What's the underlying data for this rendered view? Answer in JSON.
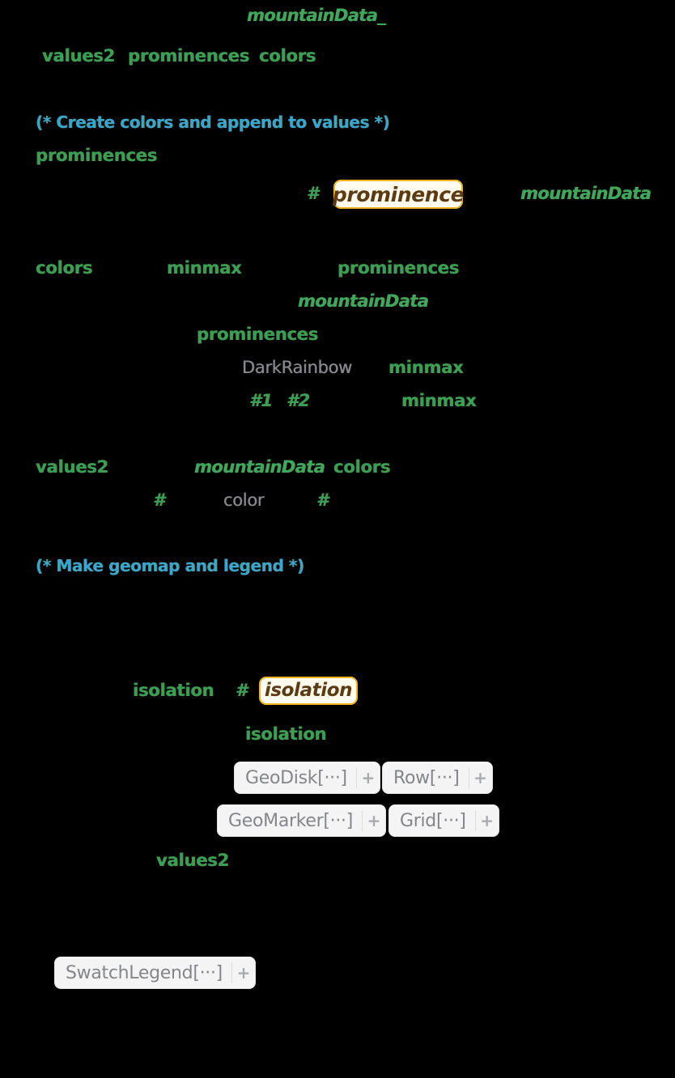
{
  "cell": {
    "kind": "wolfram-input-cell",
    "background": "#000000",
    "colors": {
      "symbol_green": "#3A9E53",
      "pattern_green": "#3FA85C",
      "comment_cyan": "#3AA6CE",
      "string_gray": "#8A8A90",
      "highlight_fill": "#FFFBEE",
      "highlight_border": "#F0B41F",
      "highlight_text": "#5C3A12",
      "elision_fill": "#F4F4F5",
      "elision_text": "#85868A"
    }
  },
  "tokens": {
    "line1": {
      "mountain_data_pattern": "mountainData_"
    },
    "line2": {
      "values2": "values2",
      "prominences": "prominences",
      "colors": "colors"
    },
    "comment1": "(* Create colors and append to values *)",
    "line3": {
      "prominences": "prominences"
    },
    "line4": {
      "slot": "#",
      "highlight_prominence": "prominence",
      "mountain_data": "mountainData"
    },
    "line5": {
      "colors": "colors",
      "minmax": "minmax",
      "prominences": "prominences"
    },
    "line6": {
      "mountain_data": "mountainData"
    },
    "line7": {
      "prominences": "prominences"
    },
    "line8": {
      "dark_rainbow": "DarkRainbow",
      "minmax": "minmax"
    },
    "line9": {
      "slot1": "#1",
      "slot2": "#2",
      "minmax": "minmax"
    },
    "line10": {
      "values2": "values2",
      "mountain_data": "mountainData",
      "colors": "colors"
    },
    "line11": {
      "slot_a": "#",
      "color_string": "color",
      "slot_b": "#"
    },
    "comment2": "(* Make geomap and legend *)",
    "line12": {
      "isolation": "isolation",
      "slot": "#",
      "highlight_isolation": "isolation"
    },
    "line13": {
      "isolation": "isolation"
    },
    "line14": {
      "values2": "values2"
    }
  },
  "elisions": [
    {
      "id": "geodisk",
      "label": "GeoDisk[···]",
      "expand": "+"
    },
    {
      "id": "row",
      "label": "Row[···]",
      "expand": "+"
    },
    {
      "id": "geomarker",
      "label": "GeoMarker[···]",
      "expand": "+"
    },
    {
      "id": "grid",
      "label": "Grid[···]",
      "expand": "+"
    },
    {
      "id": "swatchlegend",
      "label": "SwatchLegend[···]",
      "expand": "+"
    }
  ]
}
